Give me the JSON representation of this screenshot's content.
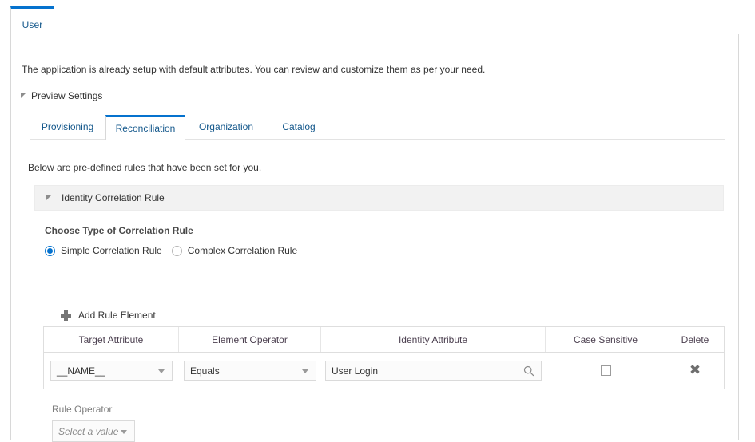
{
  "outer_tabs": [
    {
      "label": "User",
      "selected": true
    }
  ],
  "intro": {
    "text": "The application is already setup with default attributes. You can review and customize them as per your need."
  },
  "preview_settings": {
    "label": "Preview Settings",
    "expanded": true,
    "disclosure_icon": "triangle-expanded-icon"
  },
  "inner_tabs": [
    {
      "label": "Provisioning",
      "selected": false
    },
    {
      "label": "Reconciliation",
      "selected": true
    },
    {
      "label": "Organization",
      "selected": false
    },
    {
      "label": "Catalog",
      "selected": false
    }
  ],
  "section": {
    "note": "Below are pre-defined rules that have been set for you."
  },
  "rule_header": {
    "label": "Identity Correlation Rule",
    "expanded": true,
    "disclosure_icon": "triangle-expanded-icon"
  },
  "correlation_type": {
    "label": "Choose Type of Correlation Rule",
    "options": [
      {
        "label": "Simple Correlation Rule",
        "checked": true
      },
      {
        "label": "Complex Correlation Rule",
        "checked": false
      }
    ]
  },
  "add_rule_element": {
    "label": "Add Rule Element",
    "icon": "plus-icon"
  },
  "rule_table": {
    "headers": [
      "Target Attribute",
      "Element Operator",
      "Identity Attribute",
      "Case Sensitive",
      "Delete"
    ],
    "rows": [
      {
        "target_attribute": "__NAME__",
        "element_operator": "Equals",
        "identity_attribute": "User Login",
        "identity_attribute_icon": "search-icon",
        "case_sensitive_checked": false,
        "delete_icon": "close-x-icon"
      }
    ]
  },
  "rule_operator": {
    "label": "Rule Operator",
    "placeholder": "Select a value",
    "value": "Select a value"
  },
  "colors": {
    "accent": "#0572ce",
    "link": "#13578b",
    "text": "#333333",
    "muted": "#7d7d7d",
    "band": "#f2f2f2",
    "border": "#d8d8d8",
    "table_header_text": "#4b3f4f"
  }
}
